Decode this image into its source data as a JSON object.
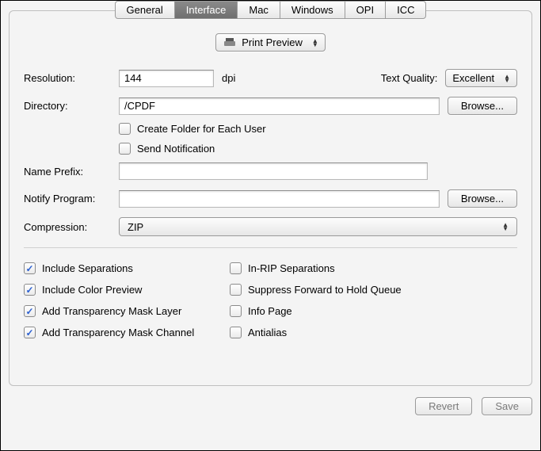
{
  "tabs": {
    "general": "General",
    "interface": "Interface",
    "mac": "Mac",
    "windows": "Windows",
    "opi": "OPI",
    "icc": "ICC"
  },
  "top_select": {
    "label": "Print Preview"
  },
  "fields": {
    "resolution_label": "Resolution:",
    "resolution_value": "144",
    "resolution_unit": "dpi",
    "text_quality_label": "Text Quality:",
    "text_quality_value": "Excellent",
    "directory_label": "Directory:",
    "directory_value": "/CPDF",
    "browse1": "Browse...",
    "create_folder": "Create Folder for Each User",
    "send_notification": "Send Notification",
    "name_prefix_label": "Name Prefix:",
    "name_prefix_value": "",
    "notify_program_label": "Notify Program:",
    "notify_program_value": "",
    "browse2": "Browse...",
    "compression_label": "Compression:",
    "compression_value": "ZIP"
  },
  "checks": {
    "include_separations": "Include Separations",
    "in_rip": "In-RIP Separations",
    "include_color_preview": "Include Color Preview",
    "suppress_forward": "Suppress Forward to Hold Queue",
    "add_mask_layer": "Add Transparency Mask Layer",
    "info_page": "Info Page",
    "add_mask_channel": "Add Transparency Mask Channel",
    "antialias": "Antialias"
  },
  "check_states": {
    "include_separations": true,
    "in_rip": false,
    "include_color_preview": true,
    "suppress_forward": false,
    "add_mask_layer": true,
    "info_page": false,
    "add_mask_channel": true,
    "antialias": false
  },
  "footer": {
    "revert": "Revert",
    "save": "Save"
  }
}
